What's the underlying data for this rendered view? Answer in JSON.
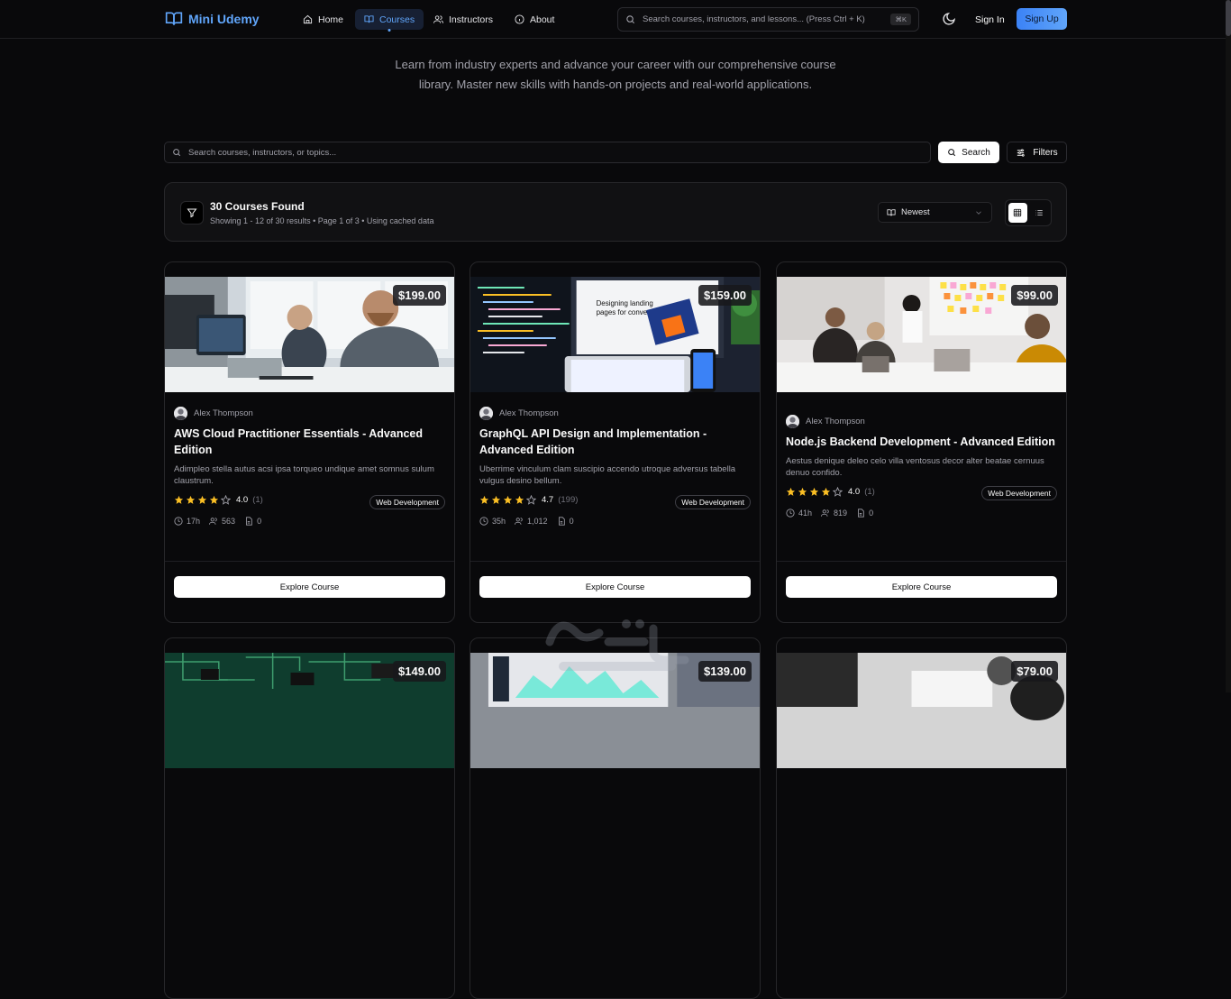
{
  "nav": {
    "brand": "Mini Udemy",
    "links": [
      {
        "label": "Home",
        "icon": "home-icon"
      },
      {
        "label": "Courses",
        "icon": "book-icon",
        "active": true
      },
      {
        "label": "Instructors",
        "icon": "users-icon"
      },
      {
        "label": "About",
        "icon": "info-icon"
      }
    ],
    "search_placeholder": "Search courses, instructors, and lessons... (Press Ctrl + K)",
    "search_shortcut": "⌘K",
    "sign_in": "Sign In",
    "sign_up": "Sign Up"
  },
  "hero": {
    "subtitle": "Learn from industry experts and advance your career with our comprehensive course library. Master new skills with hands-on projects and real-world applications."
  },
  "search": {
    "placeholder": "Search courses, instructors, or topics...",
    "button": "Search",
    "filters": "Filters"
  },
  "results": {
    "title": "30 Courses Found",
    "subtitle": "Showing 1 - 12 of 30 results • Page 1 of 3 • Using cached data",
    "sort_selected": "Newest"
  },
  "courses": [
    {
      "price": "$199.00",
      "author": "Alex Thompson",
      "title": "AWS Cloud Practitioner Essentials - Advanced Edition",
      "description": "Adimpleo stella autus acsi ipsa torqueo undique amet somnus sulum claustrum.",
      "rating": "4.0",
      "stars": 4,
      "reviews": "(1)",
      "category": "Web Development",
      "duration": "17h",
      "students": "563",
      "lessons": "0",
      "cta": "Explore Course"
    },
    {
      "price": "$159.00",
      "author": "Alex Thompson",
      "title": "GraphQL API Design and Implementation - Advanced Edition",
      "description": "Uberrime vinculum clam suscipio accendo utroque adversus tabella vulgus desino bellum.",
      "rating": "4.7",
      "stars": 4,
      "reviews": "(199)",
      "category": "Web Development",
      "duration": "35h",
      "students": "1,012",
      "lessons": "0",
      "cta": "Explore Course"
    },
    {
      "price": "$99.00",
      "author": "Alex Thompson",
      "title": "Node.js Backend Development - Advanced Edition",
      "description": "Aestus denique deleo celo villa ventosus decor alter beatae cernuus denuo confido.",
      "rating": "4.0",
      "stars": 4,
      "reviews": "(1)",
      "category": "Web Development",
      "duration": "41h",
      "students": "819",
      "lessons": "0",
      "cta": "Explore Course"
    }
  ],
  "next_row_prices": [
    "$149.00",
    "$139.00",
    "$79.00"
  ],
  "colors": {
    "background": "#09090b",
    "accent": "#60a5fa",
    "star": "#fbbf24",
    "card_border": "#27272a"
  }
}
